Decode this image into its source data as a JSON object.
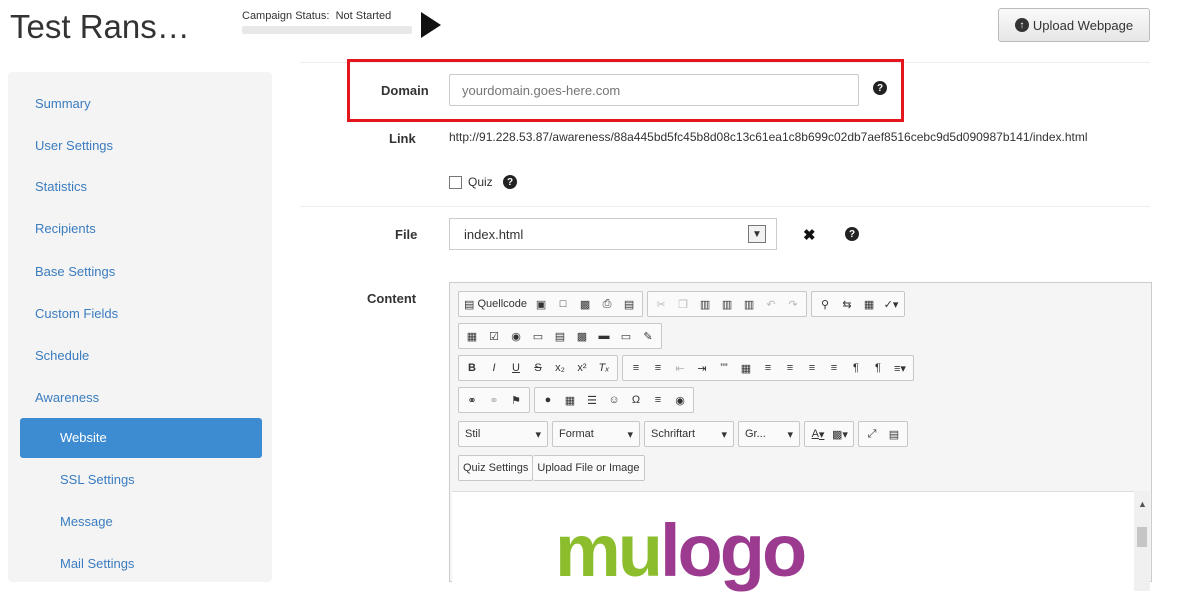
{
  "header": {
    "title": "Test Rans…",
    "campaign_status_label": "Campaign Status:",
    "campaign_status_value": "Not Started",
    "upload_button": "Upload Webpage"
  },
  "sidebar": {
    "items": [
      "Summary",
      "User Settings",
      "Statistics",
      "Recipients",
      "Base Settings",
      "Custom Fields",
      "Schedule",
      "Awareness"
    ],
    "subitems": [
      "Website",
      "SSL Settings",
      "Message",
      "Mail Settings"
    ],
    "active": "Website"
  },
  "form": {
    "domain_label": "Domain",
    "domain_placeholder": "yourdomain.goes-here.com",
    "link_label": "Link",
    "link_value": "http://91.228.53.87/awareness/88a445bd5fc45b8d08c13c61ea1c8b699c02db7aef8516cebc9d5d090987b141/index.html",
    "quiz_label": "Quiz",
    "file_label": "File",
    "file_value": "index.html",
    "content_label": "Content"
  },
  "editor": {
    "source_button": "Quellcode",
    "style_combo": "Stil",
    "format_combo": "Format",
    "font_combo": "Schriftart",
    "size_combo": "Gr...",
    "quiz_settings_button": "Quiz Settings",
    "upload_file_button": "Upload File or Image",
    "bold": "B",
    "italic": "I",
    "underline": "U",
    "strike": "S",
    "subscript": "x₂",
    "superscript": "x²",
    "clear_format": "Tₓ",
    "quote": "””",
    "omega": "Ω",
    "text_color": "A",
    "logo_part1": "mu",
    "logo_part2": "logo"
  },
  "icons": {
    "help": "question-circle-icon",
    "remove": "x-icon",
    "play": "play-icon",
    "upload": "upload-icon"
  },
  "colors": {
    "accent": "#3d8cd1",
    "highlight_border": "#e3161e",
    "link": "#3a7cc0",
    "logo_green": "#8bbd2d",
    "logo_purple": "#9b3a8f"
  }
}
